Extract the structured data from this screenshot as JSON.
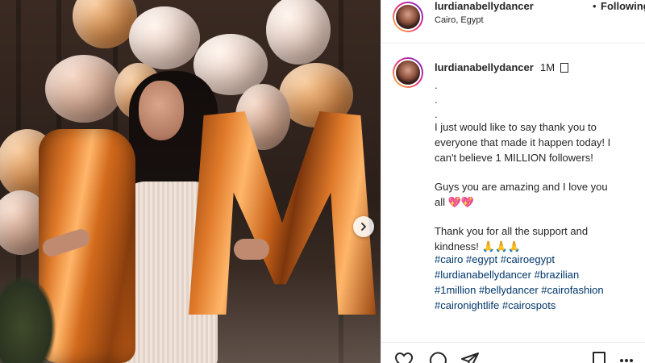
{
  "post": {
    "username": "lurdianabellydancer",
    "follow_dot": "•",
    "follow_status": "Following",
    "location": "Cairo, Egypt"
  },
  "caption": {
    "username": "lurdianabellydancer",
    "time": "1M",
    "lines": [
      ".",
      ".",
      ".",
      "I just would like to say thank you to",
      "everyone that made it happen today! I",
      "can't believe 1 MILLION followers!",
      "Guys you are amazing and I love you",
      "all 💖💖",
      "Thank you for all the support and",
      "kindness! 🙏🙏🙏"
    ],
    "hashtags": [
      [
        "#cairo",
        "#egypt",
        "#cairoegypt"
      ],
      [
        "#lurdianabellydancer",
        "#brazilian"
      ],
      [
        "#1million",
        "#bellydancer",
        "#cairofashion"
      ],
      [
        "#caironightlife",
        "#cairospots"
      ]
    ]
  },
  "icons": {
    "next": "chevron-right-icon",
    "more": "more-options-icon",
    "like": "heart-icon",
    "comment": "comment-icon",
    "share": "share-icon",
    "save": "bookmark-icon"
  },
  "colors": {
    "hashtag": "#00376b",
    "text": "#262626",
    "divider": "#efefef"
  }
}
